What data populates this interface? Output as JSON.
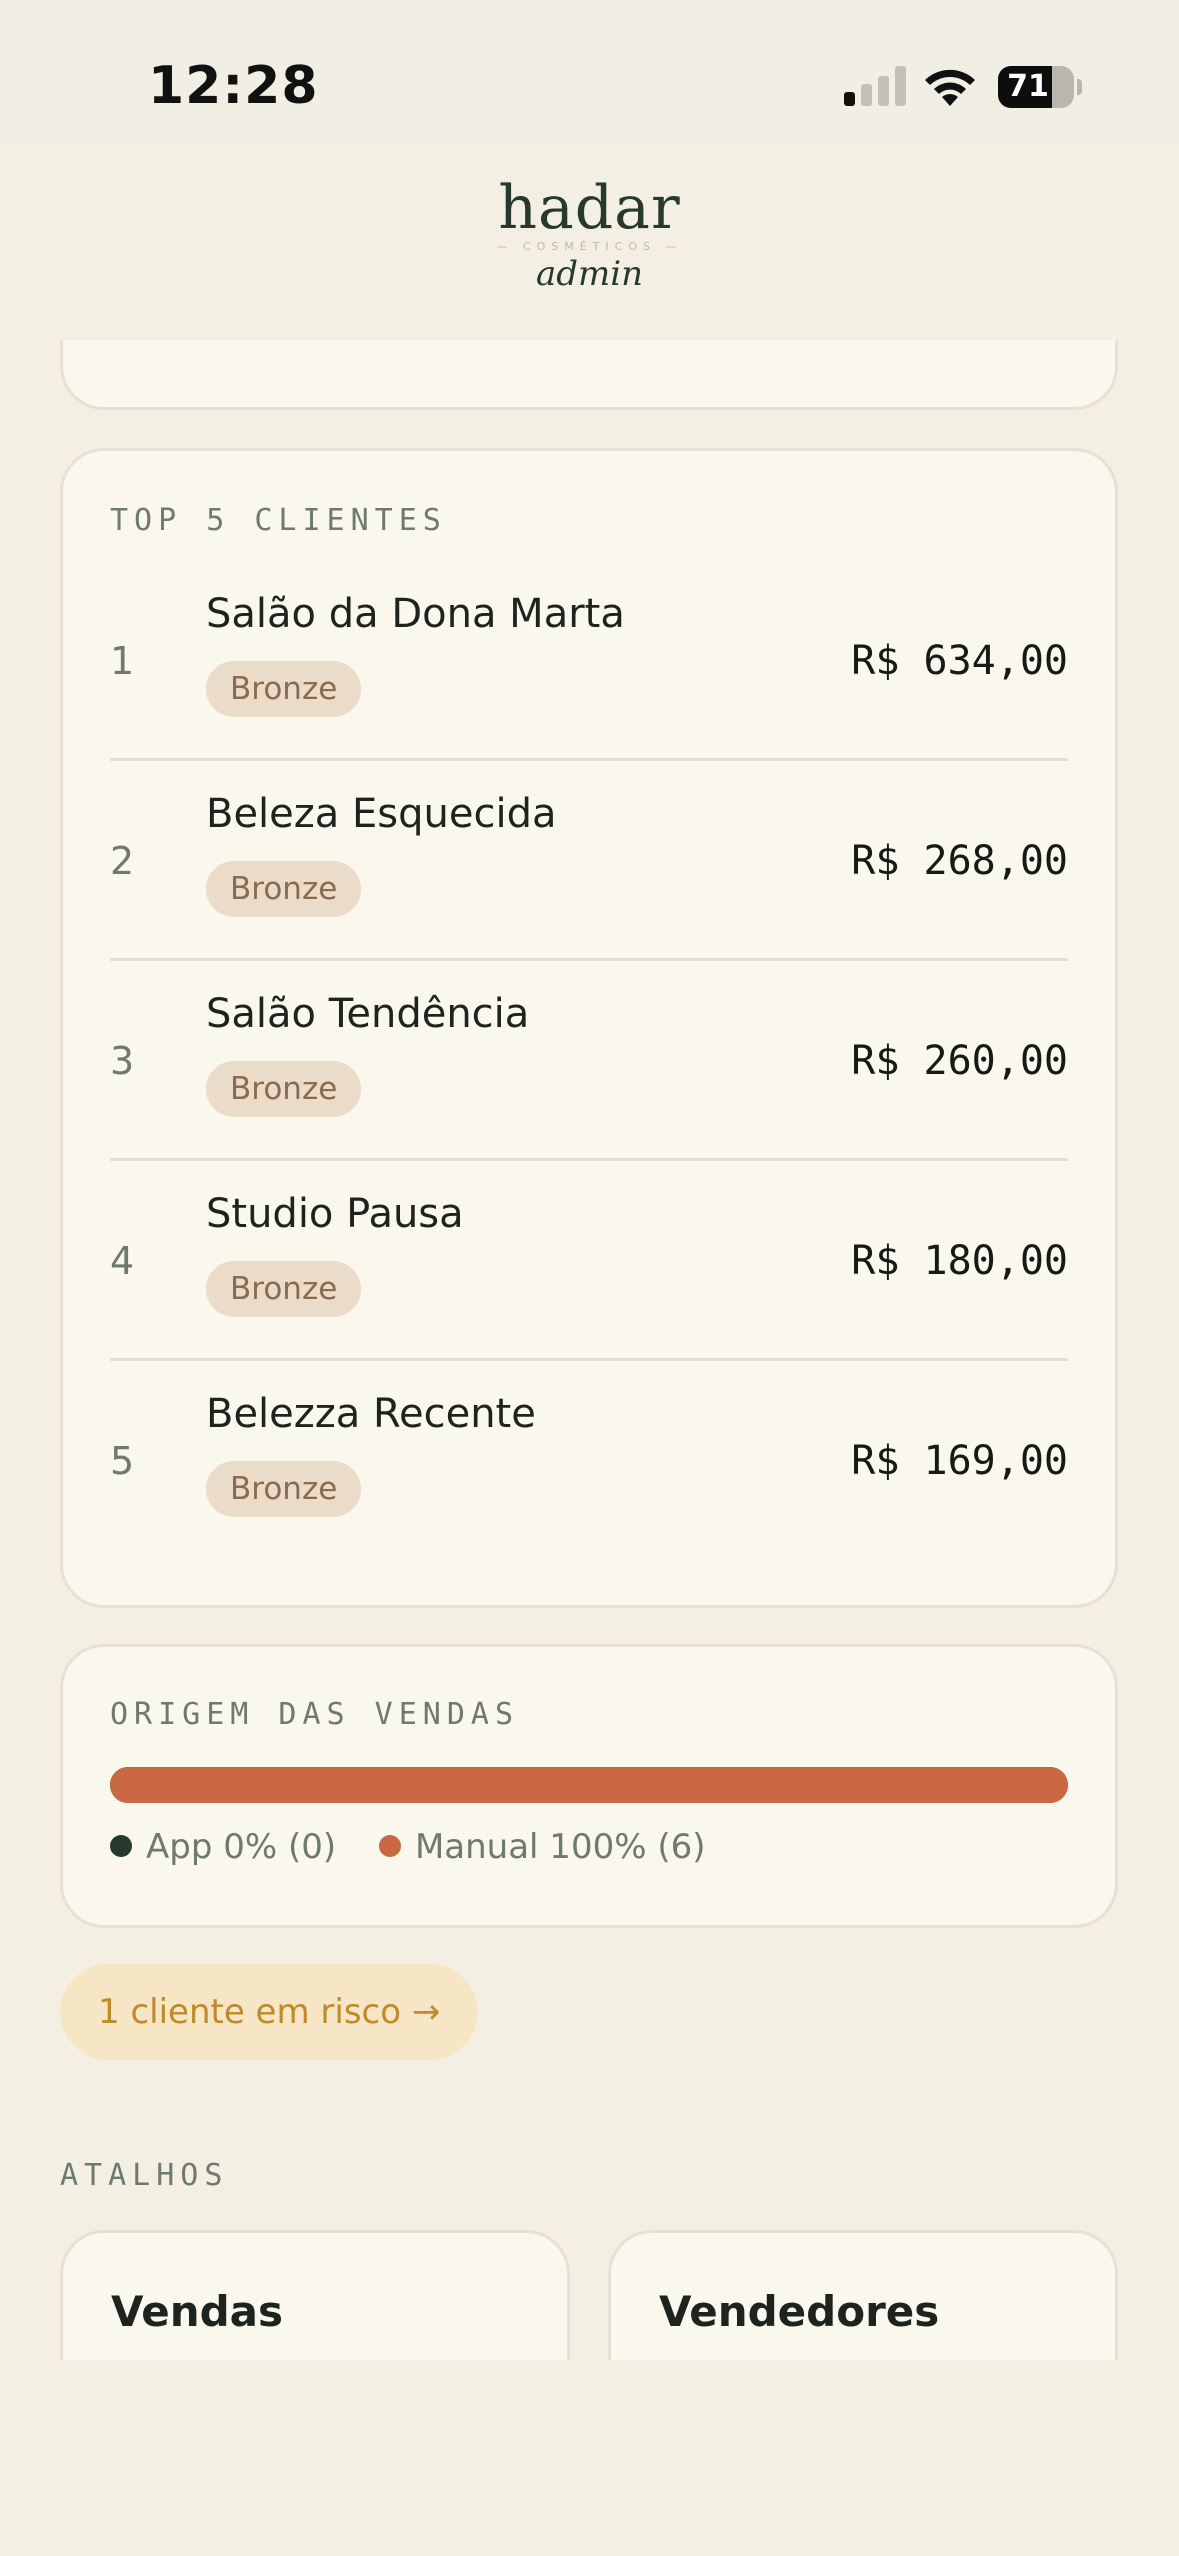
{
  "status_bar": {
    "time": "12:28",
    "battery": "71",
    "battery_level": 0.71
  },
  "logo": {
    "brand": "hadar",
    "tagline": "COSMÉTICOS",
    "section": "admin"
  },
  "top_clients": {
    "title": "TOP 5 CLIENTES",
    "rows": [
      {
        "rank": "1",
        "name": "Salão da Dona Marta",
        "tier": "Bronze",
        "amount": "R$ 634,00"
      },
      {
        "rank": "2",
        "name": "Beleza Esquecida",
        "tier": "Bronze",
        "amount": "R$ 268,00"
      },
      {
        "rank": "3",
        "name": "Salão Tendência",
        "tier": "Bronze",
        "amount": "R$ 260,00"
      },
      {
        "rank": "4",
        "name": "Studio Pausa",
        "tier": "Bronze",
        "amount": "R$ 180,00"
      },
      {
        "rank": "5",
        "name": "Belezza Recente",
        "tier": "Bronze",
        "amount": "R$ 169,00"
      }
    ]
  },
  "sales_origin": {
    "title": "ORIGEM DAS VENDAS",
    "app_share": 0,
    "manual_share": 1,
    "app_label": "App 0% (0)",
    "manual_label": "Manual 100% (6)",
    "app_color": "#27382c",
    "manual_color": "#c96842"
  },
  "risk_alert": {
    "label": "1 cliente em risco →"
  },
  "shortcuts": {
    "title": "ATALHOS",
    "items": [
      {
        "label": "Vendas"
      },
      {
        "label": "Vendedores"
      }
    ]
  }
}
